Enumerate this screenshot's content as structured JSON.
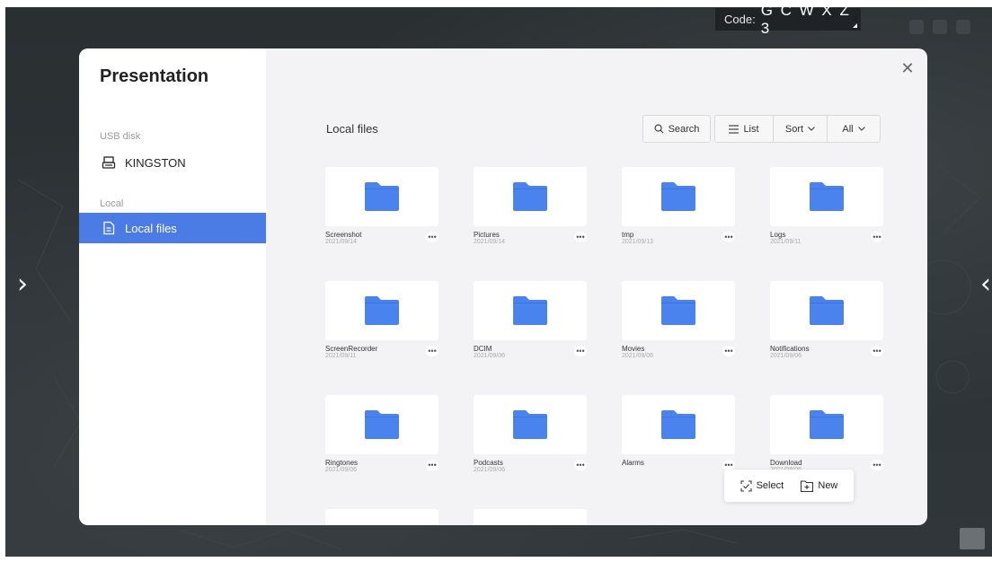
{
  "code_box": {
    "label": "Code:",
    "value": "G C W X Z 3"
  },
  "dialog": {
    "title": "Presentation",
    "sidebar": {
      "usb_section": "USB disk",
      "usb_device": "KINGSTON",
      "local_section": "Local",
      "local_item": "Local files"
    },
    "heading": "Local files",
    "toolbar": {
      "search": "Search",
      "list": "List",
      "sort": "Sort",
      "all": "All"
    },
    "files": [
      {
        "name": "Screenshot",
        "date": "2021/09/14"
      },
      {
        "name": "Pictures",
        "date": "2021/09/14"
      },
      {
        "name": "tmp",
        "date": "2021/09/13"
      },
      {
        "name": "Logs",
        "date": "2021/09/11"
      },
      {
        "name": "ScreenRecorder",
        "date": "2021/09/11"
      },
      {
        "name": "DCIM",
        "date": "2021/09/06"
      },
      {
        "name": "Movies",
        "date": "2021/09/06"
      },
      {
        "name": "Notifications",
        "date": "2021/09/06"
      },
      {
        "name": "Ringtones",
        "date": "2021/09/06"
      },
      {
        "name": "Podcasts",
        "date": "2021/09/06"
      },
      {
        "name": "Alarms",
        "date": ""
      },
      {
        "name": "Download",
        "date": "2021/09/06"
      }
    ],
    "more_label": "•••",
    "float_bar": {
      "select": "Select",
      "new": "New"
    }
  },
  "colors": {
    "accent": "#4b7be5",
    "folder": "#4a82ee",
    "folder_tab": "#3f74dc"
  },
  "icons": {
    "usb": "usb-drive-icon",
    "local": "document-icon",
    "search": "search-icon",
    "list": "list-icon",
    "sort": "chevron-down-icon",
    "folder": "folder-icon",
    "select": "select-icon",
    "new": "new-folder-icon",
    "close": "close-icon"
  }
}
